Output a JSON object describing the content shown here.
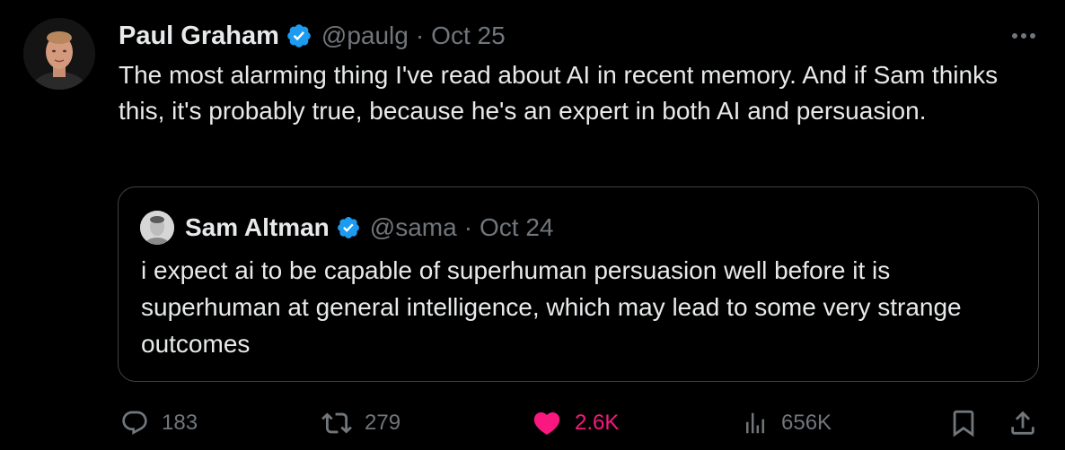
{
  "tweet": {
    "author": {
      "name": "Paul Graham",
      "handle": "@paulg",
      "date": "Oct 25",
      "verified": true,
      "avatar": "avatar-photo"
    },
    "separator": "·",
    "text": "The most alarming thing I've read about AI in recent memory. And if Sam thinks this, it's probably true, because he's an expert in both AI and persuasion.",
    "more_icon": "more-icon"
  },
  "quoted_tweet": {
    "author": {
      "name": "Sam Altman",
      "handle": "@sama",
      "date": "Oct 24",
      "verified": true,
      "avatar": "avatar-photo"
    },
    "separator": "·",
    "text": "i expect ai to be capable of superhuman persuasion well before it is superhuman at general intelligence, which may lead to some very strange outcomes"
  },
  "actions": {
    "reply": {
      "icon": "reply-icon",
      "count": "183"
    },
    "retweet": {
      "icon": "retweet-icon",
      "count": "279"
    },
    "like": {
      "icon": "heart-icon",
      "count": "2.6K",
      "liked": true
    },
    "views": {
      "icon": "views-icon",
      "count": "656K"
    },
    "bookmark": {
      "icon": "bookmark-icon"
    },
    "share": {
      "icon": "share-icon"
    }
  },
  "colors": {
    "background": "#000000",
    "primary_text": "#e7e9ea",
    "secondary_text": "#71767b",
    "verified_badge": "#1d9bf0",
    "like": "#f91880",
    "border": "#3e4144"
  }
}
